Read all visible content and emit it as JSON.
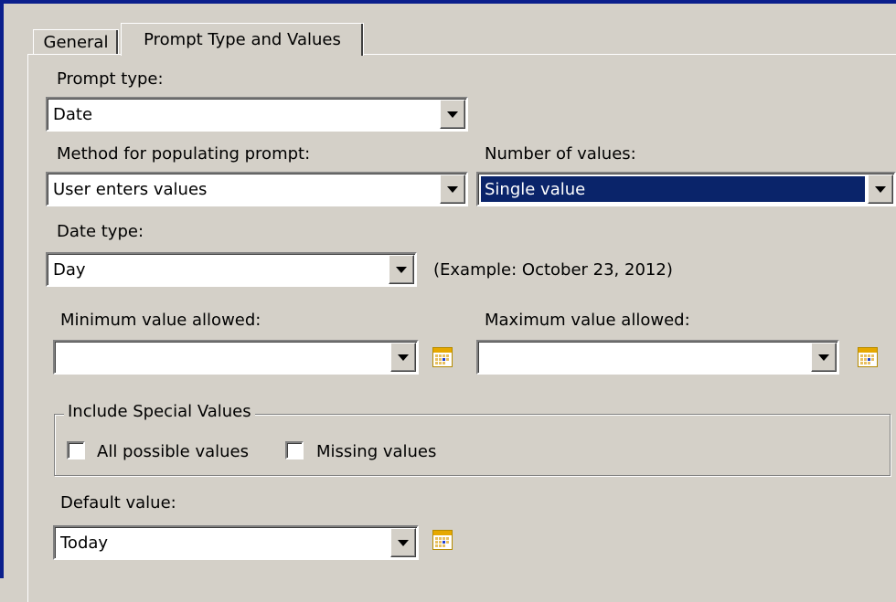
{
  "tabs": [
    {
      "label": "General",
      "active": false
    },
    {
      "label": "Prompt Type and Values",
      "active": true
    }
  ],
  "prompt_type": {
    "label": "Prompt type:",
    "value": "Date"
  },
  "method": {
    "label": "Method for populating prompt:",
    "value": "User enters values"
  },
  "number_of_values": {
    "label": "Number of values:",
    "value": "Single value"
  },
  "date_type": {
    "label": "Date type:",
    "value": "Day",
    "example": "(Example: October 23, 2012)"
  },
  "minimum": {
    "label": "Minimum value allowed:",
    "value": ""
  },
  "maximum": {
    "label": "Maximum value allowed:",
    "value": ""
  },
  "special_values": {
    "title": "Include Special Values",
    "all_possible": {
      "label": "All possible values",
      "checked": false
    },
    "missing": {
      "label": "Missing values",
      "checked": false
    }
  },
  "default_value": {
    "label": "Default value:",
    "value": "Today"
  },
  "colors": {
    "selection": "#0a246a",
    "face": "#d4d0c8",
    "frame": "#0b1f8c"
  }
}
